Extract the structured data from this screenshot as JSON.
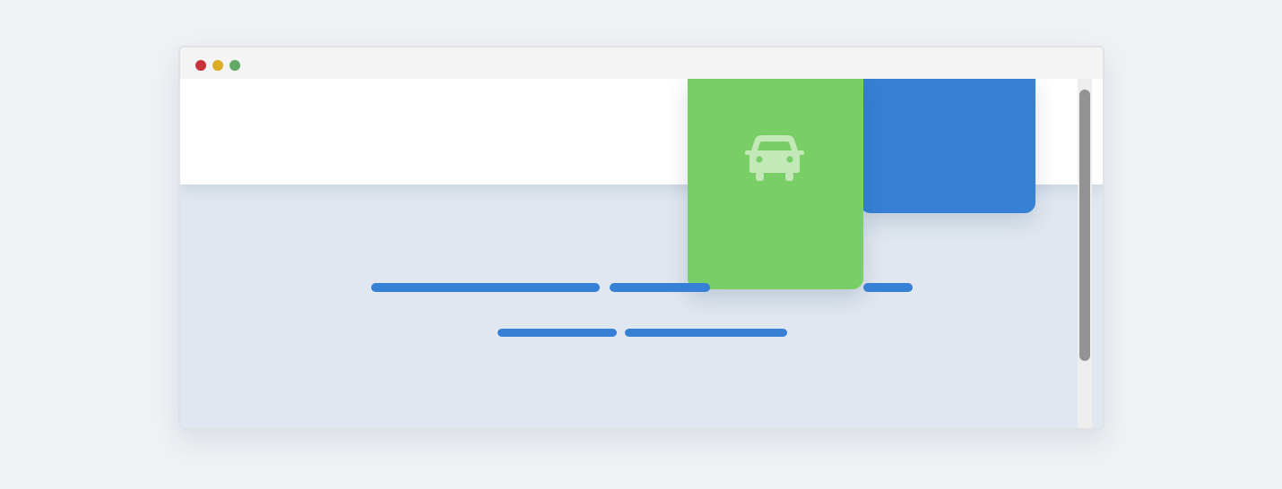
{
  "window": {
    "controls": [
      {
        "name": "close-dot",
        "color": "#c8323a"
      },
      {
        "name": "minimize-dot",
        "color": "#dbae24"
      },
      {
        "name": "maximize-dot",
        "color": "#62a866"
      }
    ]
  },
  "colors": {
    "page_background": "#eff1f5",
    "content_background": "#e0e7f0",
    "header_band": "#ffffff",
    "accent_blue": "#3680d6",
    "accent_green": "#79cf66",
    "icon_tint": "#c2e9b7",
    "scrollbar_track": "#eeeeee",
    "scrollbar_thumb": "#939393"
  },
  "cards": {
    "green": {
      "icon": "car-icon"
    },
    "blue": {}
  },
  "placeholder_text_color": "#3680d6",
  "scrollbar": {}
}
